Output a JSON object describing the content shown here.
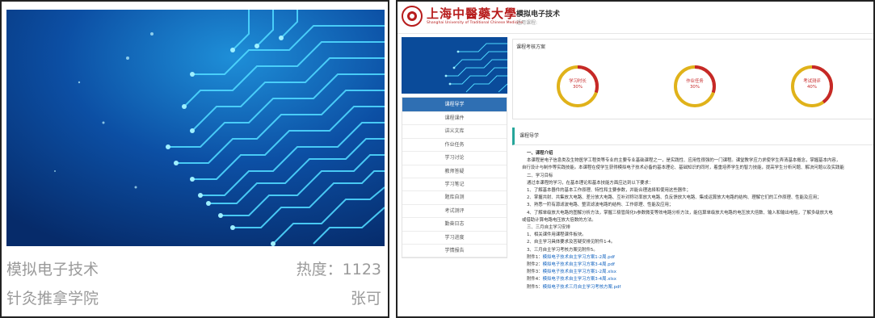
{
  "card": {
    "title": "模拟电子技术",
    "heat": "热度：1123",
    "college": "针灸推拿学院",
    "teacher": "张可"
  },
  "header": {
    "school_cn": "上海中醫藥大學",
    "school_en": "Shanghai University of Traditional Chinese Medicine",
    "course_title": "模拟电子技术",
    "course_sub": "适用课程:"
  },
  "nav": {
    "items": [
      "课程导学",
      "课程课件",
      "讲义文库",
      "作业任务",
      "学习讨论",
      "教师答疑",
      "学习笔记",
      "题库自测",
      "考试测评",
      "勤奋日志",
      "学习进度",
      "学情报告"
    ]
  },
  "assessment": {
    "title": "课程考核方案",
    "items": [
      {
        "label": "学习时长",
        "percent": "30%",
        "value": 0.3
      },
      {
        "label": "作业任务",
        "percent": "30%",
        "value": 0.3
      },
      {
        "label": "考试测评",
        "percent": "40%",
        "value": 0.4
      }
    ],
    "colors": {
      "primary": "#e0b21a",
      "accent": "#c62828"
    }
  },
  "guide": {
    "title": "课程导学",
    "s1_head": "一、课程介绍",
    "s1_p1": "本课程是电子信息类及生物医学工程类等专业的主要专业基础课程之一，是实践性、应用性很强的一门课程。课堂教学应力求使学生弄清基本概念，掌握基本内容，",
    "s1_p2": "自行设计与制作等实践技能。本课程在使学生获得模拟电子技术必备的基本理论、基础知识的同时，着重培养学生的智力技能，提高学生分析问题、解决问题以及实践能",
    "s2_head": "二、学习目标",
    "s2_intro": "通过本课程的学习，在基本理论和基本技能方面应达到以下要求：",
    "s2_1": "1、了解基本器件的基本工作原理、特性和主要参数，并能合理选择和使用这些器件；",
    "s2_2": "2、掌握共射、共集放大电路、差分放大电路、互补对称功率放大电路、负反馈放大电路、集成运算放大电路的结构、理解它们的工作原理、性能及应用；",
    "s2_3": "3、熟悉一阶有源滤波电路、整流滤波电路的结构、工作原理、性能及应用；",
    "s2_4a": "4、了解单级放大电路的图解分析方法，掌握三极管简化h参数微变等效电路分析方法，能估算单级放大电路的电压放大倍数、输入和输出电阻，了解多级放大电",
    "s2_4b": "或借助计算电路电压放大倍数的方法。",
    "s3_head": "三、三月自主学习安排",
    "s3_1": "1、相关课件用课程课件板块。",
    "s3_2": "2、自主学习具体要求及答疑安排见附件1-4。",
    "s3_3": "3、三月自主学习考核方案见附件5。",
    "attachments": [
      {
        "prefix": "附件1：",
        "file": "模拟电子技术自主学习方案1-2周.pdf"
      },
      {
        "prefix": "附件2：",
        "file": "模拟电子技术自主学习方案3-4周.pdf"
      },
      {
        "prefix": "附件3：",
        "file": "模拟电子技术自主学习方案1-2周.xlsx"
      },
      {
        "prefix": "附件4：",
        "file": "模拟电子技术自主学习方案3-4周.xlsx"
      },
      {
        "prefix": "附件5：",
        "file": "模拟电子技术三月自主学习考核方案.pdf"
      }
    ]
  }
}
